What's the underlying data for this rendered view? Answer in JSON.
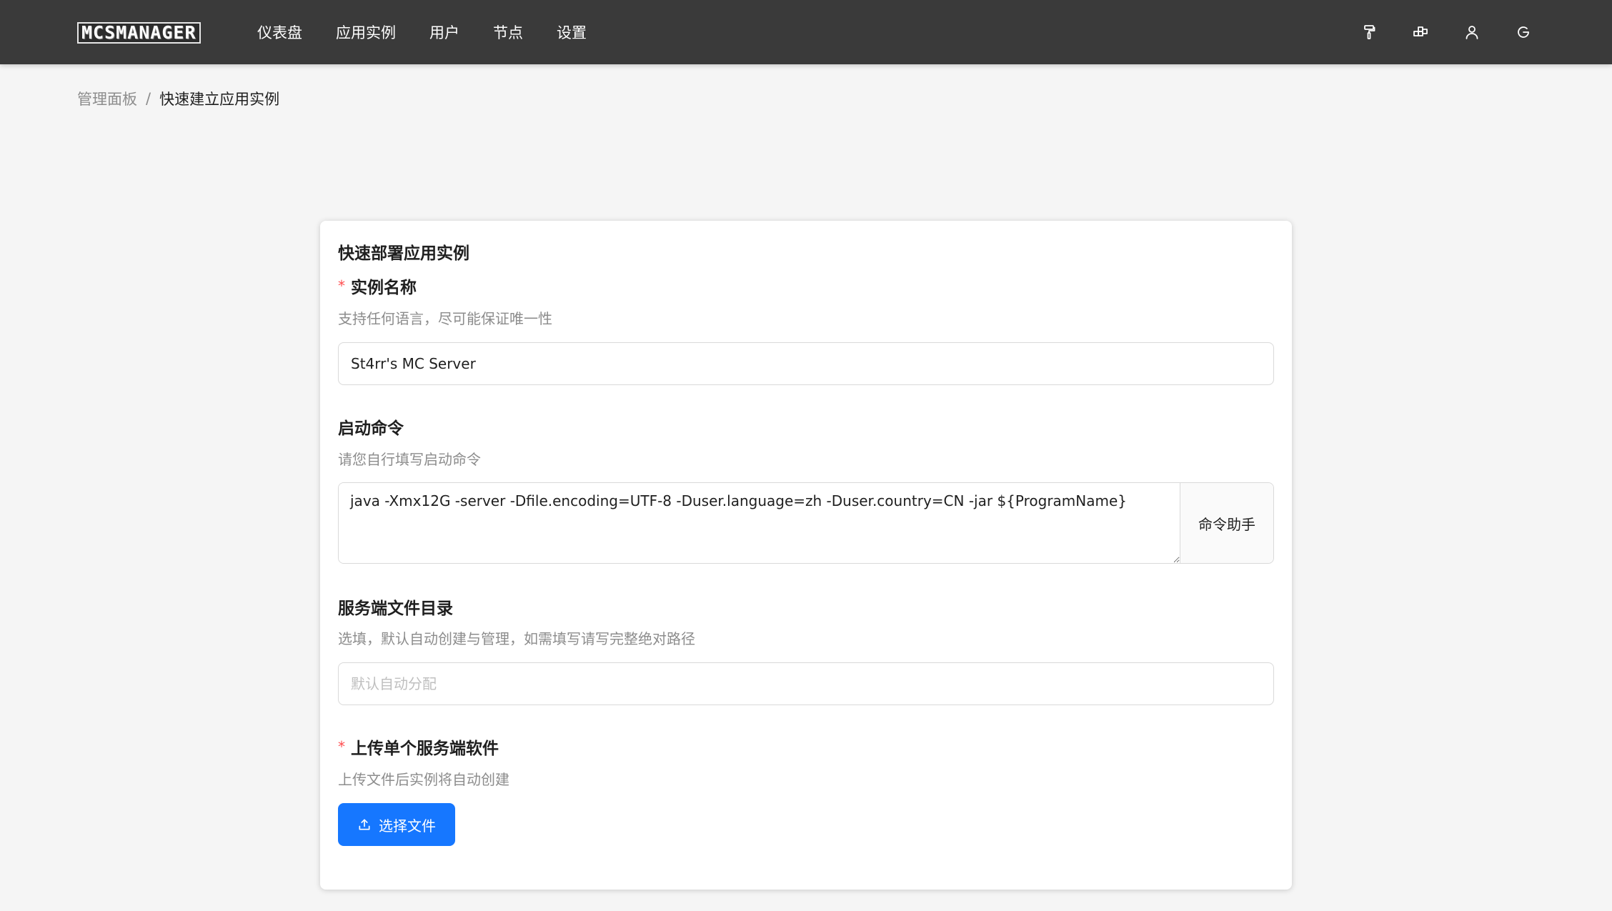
{
  "app": {
    "logo_text": "MCSMANAGER"
  },
  "nav": {
    "items": [
      {
        "label": "仪表盘"
      },
      {
        "label": "应用实例"
      },
      {
        "label": "用户"
      },
      {
        "label": "节点"
      },
      {
        "label": "设置"
      }
    ],
    "icons": [
      "paint-roller-icon",
      "apps-icon",
      "user-icon",
      "refresh-icon"
    ]
  },
  "breadcrumb": {
    "parent": "管理面板",
    "separator": "/",
    "current": "快速建立应用实例"
  },
  "form": {
    "title": "快速部署应用实例",
    "instance_name": {
      "label": "实例名称",
      "required_mark": "*",
      "description": "支持任何语言，尽可能保证唯一性",
      "value": "St4rr's MC Server"
    },
    "start_command": {
      "label": "启动命令",
      "description": "请您自行填写启动命令",
      "value": "java -Xmx12G -server -Dfile.encoding=UTF-8 -Duser.language=zh -Duser.country=CN -jar ${ProgramName}",
      "helper_button": "命令助手"
    },
    "server_directory": {
      "label": "服务端文件目录",
      "description": "选填，默认自动创建与管理，如需填写请写完整绝对路径",
      "placeholder": "默认自动分配",
      "value": ""
    },
    "upload": {
      "label": "上传单个服务端软件",
      "required_mark": "*",
      "description": "上传文件后实例将自动创建",
      "button_label": "选择文件"
    }
  }
}
